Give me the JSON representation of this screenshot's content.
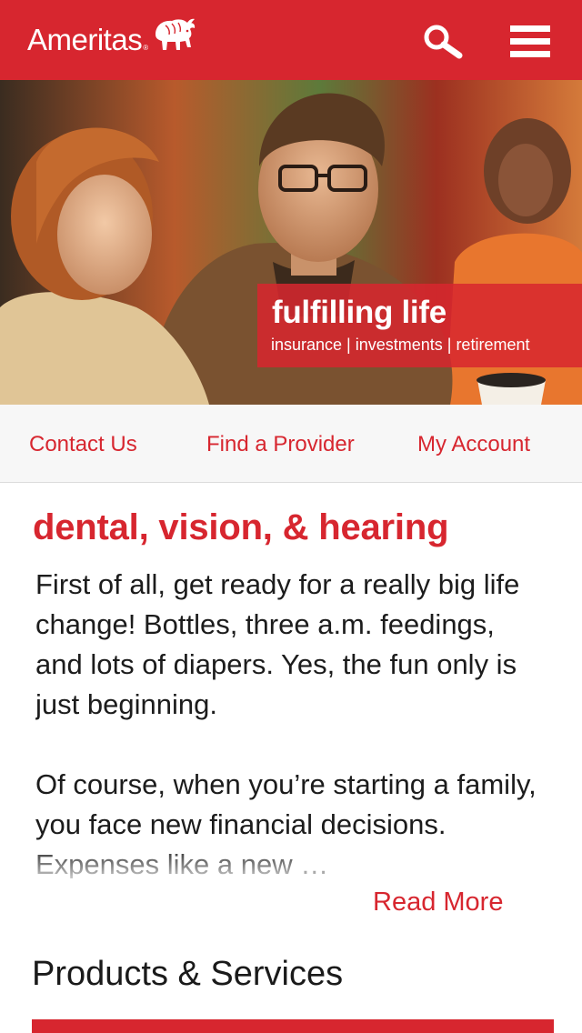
{
  "header": {
    "brand": "Ameritas",
    "registered_mark": "®",
    "icons": [
      "bison-logo-icon",
      "search-icon",
      "hamburger-menu-icon"
    ],
    "brand_color": "#d7262f"
  },
  "hero": {
    "title": "fulfilling life",
    "subtitle": "insurance | investments | retirement"
  },
  "quick_links": [
    "Contact Us",
    "Find a Provider",
    "My Account"
  ],
  "article": {
    "title": "dental, vision, & hearing",
    "paragraphs": [
      "First of all, get ready for a really big life change! Bottles, three a.m. feedings, and lots of diapers. Yes, the fun only is just beginning.",
      "Of course, when you’re starting a family, you face new financial decisions. Expenses like a new …"
    ],
    "read_more": "Read More"
  },
  "products": {
    "title": "Products & Services"
  }
}
